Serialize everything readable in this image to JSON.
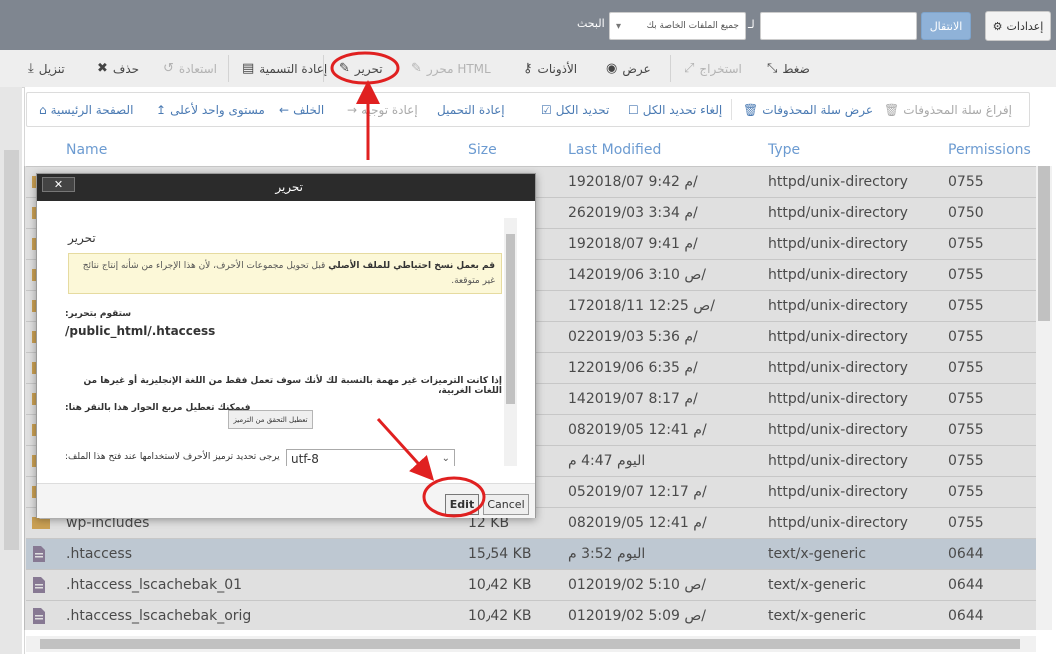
{
  "topbar": {
    "settings_label": "إعدادات",
    "go_label": "الانتقال",
    "path_value": "",
    "for_label": "لـ",
    "scope_value": "جميع الملفات الخاصة بك",
    "search_label": "البحث"
  },
  "toolbar": {
    "items": [
      {
        "label": "تنزيل",
        "icon": "download-icon"
      },
      {
        "label": "حذف",
        "icon": "close-icon"
      },
      {
        "label": "استعادة",
        "icon": "restore-icon"
      },
      {
        "label": "إعادة التسمية",
        "icon": "file-icon"
      },
      {
        "label": "تحرير",
        "icon": "pencil-icon"
      },
      {
        "label": "محرر HTML",
        "icon": "edit-icon"
      },
      {
        "label": "الأذونات",
        "icon": "key-icon"
      },
      {
        "label": "عرض",
        "icon": "eye-icon"
      },
      {
        "label": "استخراج",
        "icon": "extract-icon"
      },
      {
        "label": "ضغط",
        "icon": "compress-icon"
      }
    ]
  },
  "nav": {
    "items": [
      {
        "label": "الصفحة الرئيسية",
        "icon": "home-icon"
      },
      {
        "label": "مستوى واحد لأعلى",
        "icon": "level-up-icon"
      },
      {
        "label": "الخلف",
        "icon": "arrow-left-icon"
      },
      {
        "label": "إعادة توجيه",
        "icon": "arrow-right-icon"
      },
      {
        "label": "إعادة التحميل",
        "icon": "reload-icon"
      },
      {
        "label": "تحديد الكل",
        "icon": "checkbox-checked-icon"
      },
      {
        "label": "إلغاء تحديد الكل",
        "icon": "checkbox-icon"
      },
      {
        "label": "عرض سلة المحذوفات",
        "icon": "trash-icon"
      },
      {
        "label": "إفراغ سلة المحذوفات",
        "icon": "trash-icon"
      }
    ]
  },
  "table": {
    "headers": {
      "name": "Name",
      "size": "Size",
      "modified": "Last Modified",
      "type": "Type",
      "perms": "Permissions"
    },
    "rows": [
      {
        "name": "",
        "size": "",
        "modified": "19م 9:42 2018/07/",
        "type": "httpd/unix-directory",
        "perms": "0755",
        "kind": "folder"
      },
      {
        "name": "",
        "size": "",
        "modified": "26م 3:34 2019/03/",
        "type": "httpd/unix-directory",
        "perms": "0750",
        "kind": "folder"
      },
      {
        "name": "",
        "size": "",
        "modified": "19م 9:41 2018/07/",
        "type": "httpd/unix-directory",
        "perms": "0755",
        "kind": "folder"
      },
      {
        "name": "",
        "size": "",
        "modified": "14ص 3:10 2019/06/",
        "type": "httpd/unix-directory",
        "perms": "0755",
        "kind": "folder"
      },
      {
        "name": "",
        "size": "",
        "modified": "17ص 12:25 2018/11/",
        "type": "httpd/unix-directory",
        "perms": "0755",
        "kind": "folder"
      },
      {
        "name": "",
        "size": "",
        "modified": "02م 5:36 2019/03/",
        "type": "httpd/unix-directory",
        "perms": "0755",
        "kind": "folder"
      },
      {
        "name": "",
        "size": "",
        "modified": "12م 6:35 2019/06/",
        "type": "httpd/unix-directory",
        "perms": "0755",
        "kind": "folder"
      },
      {
        "name": "",
        "size": "",
        "modified": "14م 8:17 2019/07/",
        "type": "httpd/unix-directory",
        "perms": "0755",
        "kind": "folder"
      },
      {
        "name": "",
        "size": "",
        "modified": "08م 12:41 2019/05/",
        "type": "httpd/unix-directory",
        "perms": "0755",
        "kind": "folder"
      },
      {
        "name": "",
        "size": "",
        "modified": "اليوم 4:47 م",
        "type": "httpd/unix-directory",
        "perms": "0755",
        "kind": "folder"
      },
      {
        "name": "",
        "size": "",
        "modified": "05م 12:17 2019/07/",
        "type": "httpd/unix-directory",
        "perms": "0755",
        "kind": "folder"
      },
      {
        "name": "wp-includes",
        "size": "12 KB",
        "modified": "08م 12:41 2019/05/",
        "type": "httpd/unix-directory",
        "perms": "0755",
        "kind": "folder"
      },
      {
        "name": ".htaccess",
        "size": "15٫54 KB",
        "modified": "اليوم 3:52 م",
        "type": "text/x-generic",
        "perms": "0644",
        "kind": "file",
        "selected": true
      },
      {
        "name": ".htaccess_lscachebak_01",
        "size": "10٫42 KB",
        "modified": "01ص 5:10 2019/02/",
        "type": "text/x-generic",
        "perms": "0644",
        "kind": "file"
      },
      {
        "name": ".htaccess_lscachebak_orig",
        "size": "10٫42 KB",
        "modified": "01ص 5:09 2019/02/",
        "type": "text/x-generic",
        "perms": "0644",
        "kind": "file"
      }
    ]
  },
  "dialog": {
    "title": "تحرير",
    "close_label": "✕",
    "heading": "تحرير",
    "warning_bold": "قم بعمل نسخ احتياطي للملف الأصلي",
    "warning_rest": " قبل تحويل مجموعات الأحرف، لأن هذا الإجراء من شأنه إنتاج نتائج غير متوقعة.",
    "editing_label": ":ستقوم بتحرير",
    "file_path": "/public_html/.htaccess",
    "encoding_note": "إذا كانت الترميزات غير مهمة بالنسبة لك لأنك سوف تعمل فقط من اللغة الإنجليزية أو غيرها من اللغات الغربية،",
    "disable_prompt": ":فيمكنك تعطيل مربع الحوار هذا بالنقر هنا",
    "disable_button": "تعطيل التحقق من الترميز",
    "encoding_prompt": ":يرجى تحديد ترميز الأحرف لاستخدامها عند فتح هذا الملف",
    "encoding_value": "utf-8",
    "edit_button": "Edit",
    "cancel_button": "Cancel"
  },
  "colors": {
    "annotation": "#e02020",
    "header_link": "#6c9bd1",
    "topbar": "#7f8690",
    "selected_row": "#d9e4ef"
  }
}
